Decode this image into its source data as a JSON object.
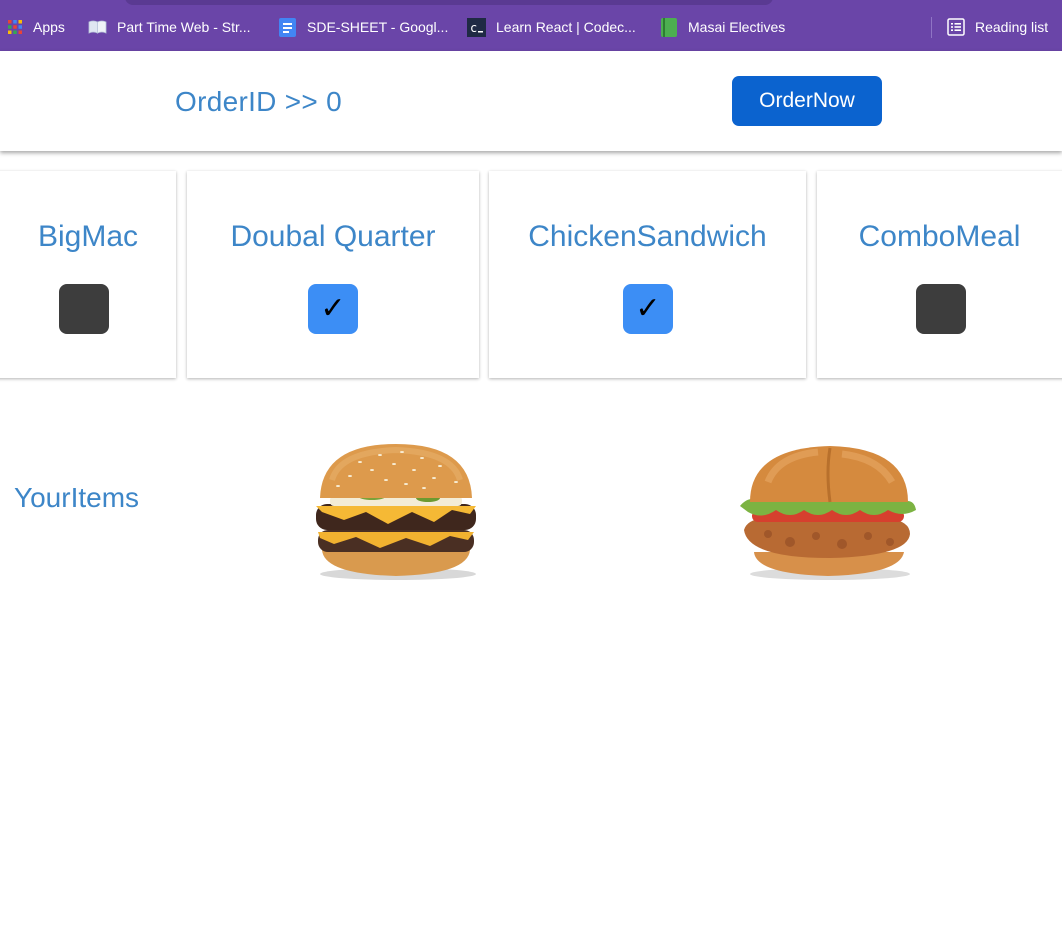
{
  "bookmarks": {
    "items": [
      {
        "label": "Apps",
        "icon": "apps-grid-icon"
      },
      {
        "label": "Part Time Web - Str...",
        "icon": "book-icon"
      },
      {
        "label": "SDE-SHEET - Googl...",
        "icon": "google-docs-icon"
      },
      {
        "label": "Learn React | Codec...",
        "icon": "codecademy-icon"
      },
      {
        "label": "Masai Electives",
        "icon": "green-book-icon"
      }
    ],
    "reading_list": {
      "label": "Reading list",
      "icon": "reading-list-icon"
    }
  },
  "header": {
    "order_id": "OrderID >> 0",
    "order_button": "OrderNow"
  },
  "menu": {
    "items": [
      {
        "name": "BigMac",
        "checked": false
      },
      {
        "name": "Doubal Quarter",
        "checked": true
      },
      {
        "name": "ChickenSandwich",
        "checked": true
      },
      {
        "name": "ComboMeal",
        "checked": false
      }
    ],
    "check_glyph": "✓"
  },
  "your_items": {
    "label": "YourItems",
    "images": [
      "double-quarter-pounder-image",
      "chicken-sandwich-image"
    ]
  },
  "colors": {
    "bookmark_bar": "#6a45a8",
    "accent_text": "#3d86c8",
    "button": "#0b63cf",
    "checked": "#3c8ef5",
    "unchecked": "#3d3d3d"
  }
}
